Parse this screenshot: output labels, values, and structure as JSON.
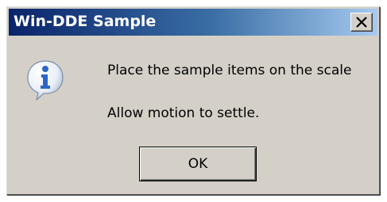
{
  "window": {
    "title": "Win-DDE Sample",
    "close_glyph": "X"
  },
  "message": {
    "icon": "information-icon",
    "line1": "Place the sample items on the scale",
    "line2": "Allow motion to settle."
  },
  "buttons": {
    "ok_label": "OK"
  },
  "colors": {
    "dialog_bg": "#d4d0c8",
    "titlebar_start": "#0a246a",
    "titlebar_end": "#a6caf0",
    "icon_blue": "#2b66c9"
  }
}
